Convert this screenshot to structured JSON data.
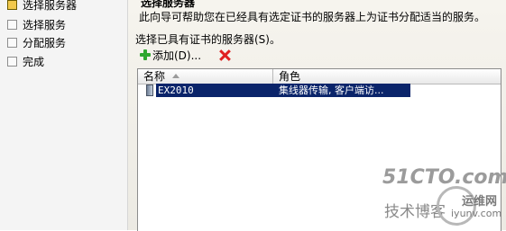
{
  "sidebar": {
    "steps": [
      {
        "label": "选择服务器",
        "current": true
      },
      {
        "label": "选择服务",
        "current": false
      },
      {
        "label": "分配服务",
        "current": false
      },
      {
        "label": "完成",
        "current": false
      }
    ]
  },
  "main": {
    "title": "选择服务器",
    "description": "此向导可帮助您在已经具有选定证书的服务器上为证书分配适当的服务。",
    "server_prompt": "选择已具有证书的服务器(S)。"
  },
  "toolbar": {
    "add_label": "添加(D)...",
    "add_icon": "green-plus-icon",
    "delete_icon": "red-x-icon"
  },
  "list": {
    "columns": [
      "名称",
      "角色"
    ],
    "rows": [
      {
        "name": "EX2010",
        "role": "集线器传输, 客户端访..."
      }
    ]
  },
  "watermark": {
    "site": "51CTO.com",
    "blog": "技术博客",
    "brand": "运维网",
    "domain": "iyunv.com"
  }
}
